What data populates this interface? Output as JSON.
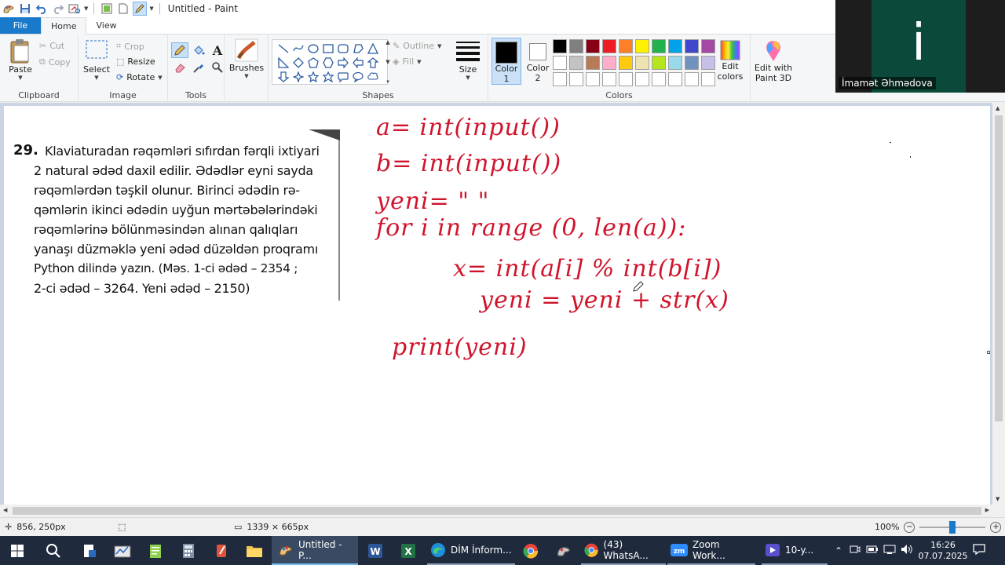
{
  "window": {
    "title": "Untitled - Paint"
  },
  "tabs": [
    {
      "label": "File"
    },
    {
      "label": "Home"
    },
    {
      "label": "View"
    }
  ],
  "ribbon": {
    "clipboard": {
      "label": "Clipboard",
      "paste": "Paste",
      "cut": "Cut",
      "copy": "Copy"
    },
    "image": {
      "label": "Image",
      "select": "Select",
      "crop": "Crop",
      "resize": "Resize",
      "rotate": "Rotate"
    },
    "tools": {
      "label": "Tools"
    },
    "brushes": {
      "label": "Brushes"
    },
    "shapes": {
      "label": "Shapes",
      "outline": "Outline",
      "fill": "Fill"
    },
    "size": {
      "label": "Size"
    },
    "colors": {
      "label": "Colors",
      "color1": "Color",
      "color1_num": "1",
      "color2": "Color",
      "color2_num": "2",
      "edit": "Edit",
      "edit2": "colors",
      "palette_row1": [
        "#000000",
        "#7f7f7f",
        "#880015",
        "#ed1c24",
        "#ff7f27",
        "#fff200",
        "#22b14c",
        "#00a2e8",
        "#3f48cc",
        "#a349a4"
      ],
      "palette_row2": [
        "#ffffff",
        "#c3c3c3",
        "#b97a57",
        "#ffaec9",
        "#ffc90e",
        "#efe4b0",
        "#b5e61d",
        "#99d9ea",
        "#7092be",
        "#c8bfe7"
      ],
      "palette_row3": [
        "#ffffff",
        "#ffffff",
        "#ffffff",
        "#ffffff",
        "#ffffff",
        "#ffffff",
        "#ffffff",
        "#ffffff",
        "#ffffff",
        "#ffffff"
      ]
    },
    "paint3d": {
      "line1": "Edit with",
      "line2": "Paint 3D"
    }
  },
  "textbook": {
    "number": "29.",
    "lines": [
      "Klaviaturadan rəqəmləri sıfırdan fərqli ixtiyari",
      "2 natural ədəd daxil edilir. Ədədlər eyni sayda",
      "rəqəmlərdən təşkil olunur. Birinci ədədin rə-",
      "qəmlərin ikinci ədədin uyğun mərtəbələrindəki",
      "rəqəmlərinə bölünməsindən alınan qalıqları",
      "yanaşı düzməklə yeni ədəd düzəldən proqramı",
      "Python dilində yazın. (Məs. 1-ci ədəd – 2354 ;",
      "2-ci ədəd – 3264. Yeni ədəd – 2150)"
    ]
  },
  "handwriting": [
    "a= int(input())",
    "b= int(input())",
    "yeni= \" \"",
    "for i in range (0, len(a)):",
    "x= int(a[i] % int(b[i])",
    "yeni = yeni + str(x)",
    "print(yeni)"
  ],
  "status": {
    "cursor": "856, 250px",
    "canvas_size": "1339 × 665px",
    "zoom": "100%",
    "zoom_level": 0.5
  },
  "zoom_call": {
    "initial": "i",
    "name": "İmamət Əhmədova"
  },
  "taskbar": {
    "paint": "Untitled - P...",
    "edge": "DİM İnform...",
    "whatsapp": "(43) WhatsA...",
    "zoom": "Zoom Work...",
    "video": "10-y...",
    "time": "16:26",
    "date": "07.07.2025"
  }
}
